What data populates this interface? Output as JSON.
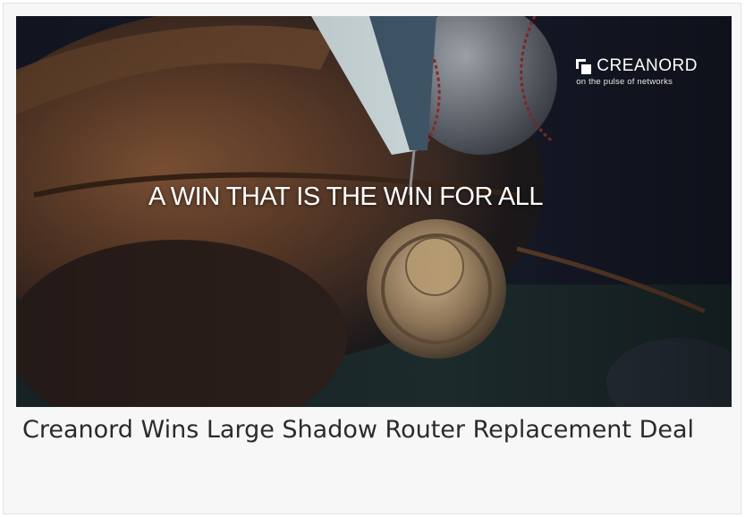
{
  "article": {
    "title": "Creanord Wins Large Shadow Router Replacement Deal",
    "image_alt": "Baseball glove, ball and medal"
  },
  "hero": {
    "headline": "A WIN THAT IS THE WIN FOR ALL",
    "brand_name": "CREANORD",
    "brand_tagline": "on the pulse of networks",
    "brand_icon": "creanord-logo-icon",
    "colors": {
      "background": "#141826",
      "text": "#ffffff",
      "card": "#f7f7f7",
      "title_text": "#2b2b2b"
    }
  }
}
